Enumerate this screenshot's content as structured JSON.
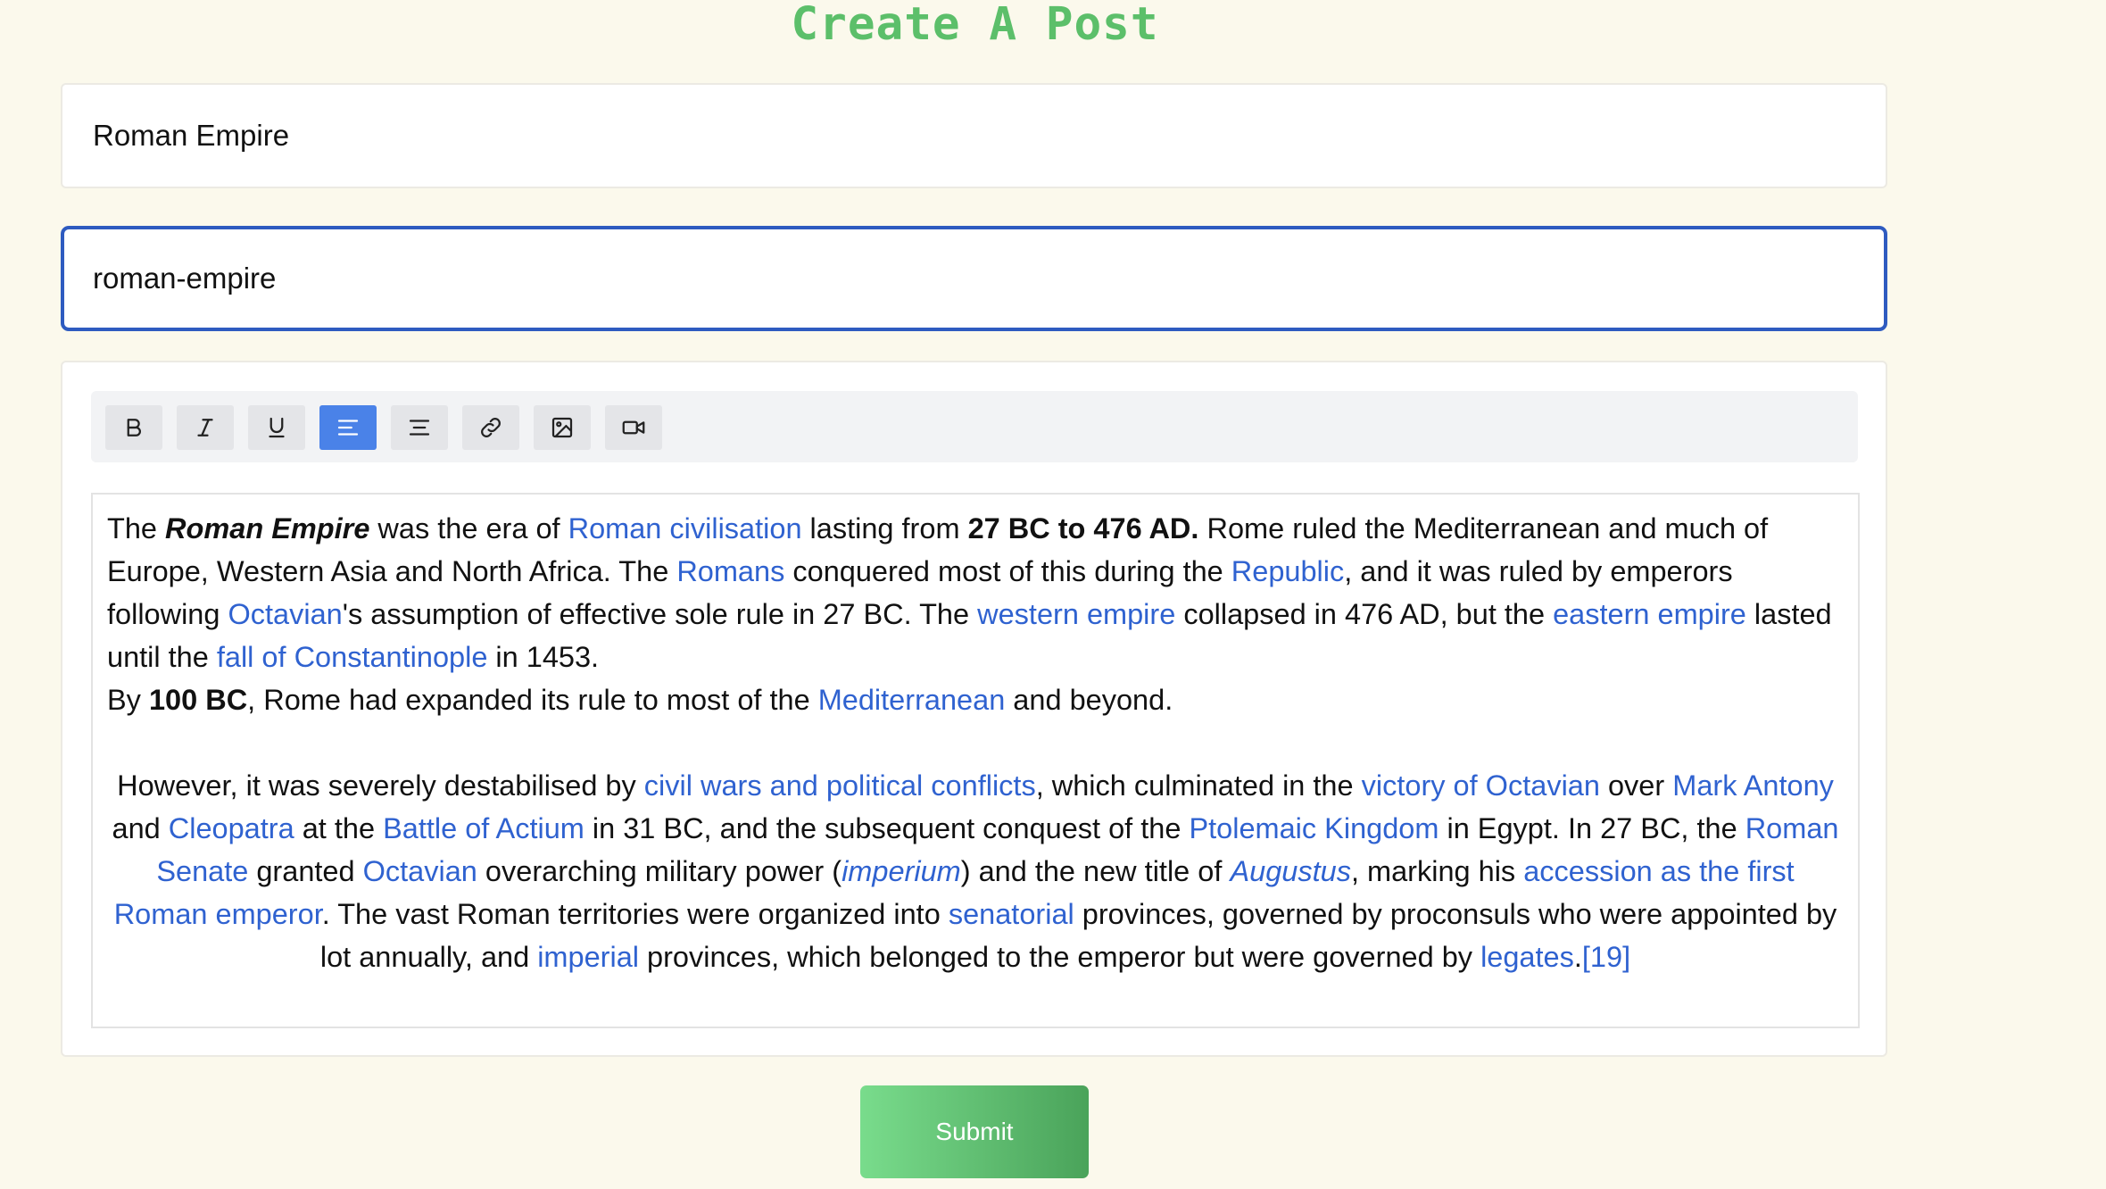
{
  "page": {
    "title": "Create A Post"
  },
  "form": {
    "title_value": "Roman Empire",
    "slug_value": "roman-empire",
    "submit_label": "Submit"
  },
  "toolbar": {
    "buttons": [
      {
        "name": "bold",
        "icon": "bold-icon",
        "active": false
      },
      {
        "name": "italic",
        "icon": "italic-icon",
        "active": false
      },
      {
        "name": "underline",
        "icon": "underline-icon",
        "active": false
      },
      {
        "name": "align-left",
        "icon": "align-left-icon",
        "active": true
      },
      {
        "name": "align-center",
        "icon": "align-center-icon",
        "active": false
      },
      {
        "name": "link",
        "icon": "link-icon",
        "active": false
      },
      {
        "name": "image",
        "icon": "image-icon",
        "active": false
      },
      {
        "name": "video",
        "icon": "video-icon",
        "active": false
      }
    ]
  },
  "content": {
    "p1": [
      {
        "t": "The "
      },
      {
        "t": "Roman Empire",
        "s": "bi"
      },
      {
        "t": " was the era of "
      },
      {
        "t": "Roman civilisation",
        "s": "link"
      },
      {
        "t": " lasting from "
      },
      {
        "t": "27 BC to 476 AD.",
        "s": "b"
      },
      {
        "t": " Rome ruled the Mediterranean and much of Europe, Western Asia and North Africa. The "
      },
      {
        "t": "Romans",
        "s": "link"
      },
      {
        "t": " conquered most of this during the "
      },
      {
        "t": "Republic",
        "s": "link"
      },
      {
        "t": ", and it was ruled by emperors following "
      },
      {
        "t": "Octavian",
        "s": "link"
      },
      {
        "t": "'s assumption of effective sole rule in 27 BC. The "
      },
      {
        "t": "western empire",
        "s": "link"
      },
      {
        "t": " collapsed in 476 AD, but the "
      },
      {
        "t": "eastern empire",
        "s": "link"
      },
      {
        "t": " lasted until the "
      },
      {
        "t": "fall of Constantinople",
        "s": "link"
      },
      {
        "t": " in 1453."
      }
    ],
    "p2": [
      {
        "t": "By "
      },
      {
        "t": "100 BC",
        "s": "b"
      },
      {
        "t": ", Rome had expanded its rule to most of the "
      },
      {
        "t": "Mediterranean",
        "s": "link"
      },
      {
        "t": " and beyond."
      }
    ],
    "p3": [
      {
        "t": "However, it was severely destabilised by "
      },
      {
        "t": "civil wars and political conflicts",
        "s": "link"
      },
      {
        "t": ", which culminated in the "
      },
      {
        "t": "victory of Octavian",
        "s": "link"
      },
      {
        "t": " over "
      },
      {
        "t": "Mark Antony",
        "s": "link"
      },
      {
        "t": " and "
      },
      {
        "t": "Cleopatra",
        "s": "link"
      },
      {
        "t": " at the "
      },
      {
        "t": "Battle of Actium",
        "s": "link"
      },
      {
        "t": " in 31 BC, and the subsequent conquest of the "
      },
      {
        "t": "Ptolemaic Kingdom",
        "s": "link"
      },
      {
        "t": " in Egypt. In 27 BC, the "
      },
      {
        "t": "Roman Senate",
        "s": "link"
      },
      {
        "t": " granted "
      },
      {
        "t": "Octavian",
        "s": "link"
      },
      {
        "t": " overarching military power ("
      },
      {
        "t": "imperium",
        "s": "link-it"
      },
      {
        "t": ") and the new title of "
      },
      {
        "t": "Augustus",
        "s": "link-it"
      },
      {
        "t": ", marking his "
      },
      {
        "t": "accession as the first Roman emperor",
        "s": "link"
      },
      {
        "t": ". The vast Roman territories were organized into "
      },
      {
        "t": "senatorial",
        "s": "link"
      },
      {
        "t": " provinces, governed by proconsuls who were appointed by lot annually, and "
      },
      {
        "t": "imperial",
        "s": "link"
      },
      {
        "t": " provinces, which belonged to the emperor but were governed by "
      },
      {
        "t": "legates",
        "s": "link"
      },
      {
        "t": "."
      },
      {
        "t": "[19]",
        "s": "link"
      }
    ]
  },
  "colors": {
    "background": "#fbf9ec",
    "title_green": "#5cbf6a",
    "link_blue": "#2f62d0",
    "focus_border": "#2e5bc0",
    "active_button": "#4a82e8"
  }
}
